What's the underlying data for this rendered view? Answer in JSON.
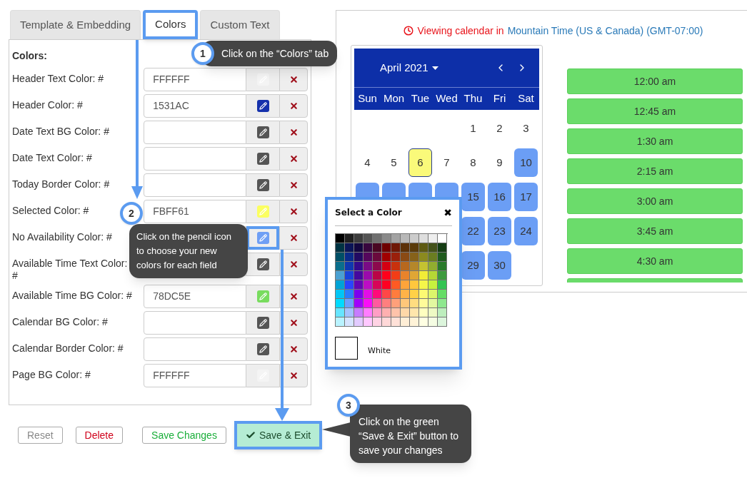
{
  "tabs": [
    {
      "label": "Template & Embedding",
      "selected": false,
      "highlighted": false
    },
    {
      "label": "Colors",
      "selected": true,
      "highlighted": true
    },
    {
      "label": "Custom Text",
      "selected": false,
      "highlighted": false
    }
  ],
  "section_title": "Colors:",
  "color_fields": [
    {
      "label": "Header Text Color: #",
      "value": "FFFFFF",
      "color": "#f4f4f4",
      "highlighted": false
    },
    {
      "label": "Header Color: #",
      "value": "1531AC",
      "color": "#1531ac",
      "highlighted": false
    },
    {
      "label": "Date Text BG Color: #",
      "color": "#555555",
      "highlighted": false
    },
    {
      "label": "Date Text Color: #",
      "color": "#555555",
      "highlighted": false
    },
    {
      "label": "Today Border Color: #",
      "color": "#555555",
      "highlighted": false
    },
    {
      "label": "Selected Color: #",
      "value": "FBFF61",
      "color": "#fbff61",
      "highlighted": false
    },
    {
      "label": "No Availability Color: #",
      "color": "#6f9ff5",
      "highlighted": true
    },
    {
      "label": "Available Time Text Color: #",
      "color": "#555555",
      "highlighted": false
    },
    {
      "label": "Available Time BG Color: #",
      "value": "78DC5E",
      "color": "#78dc5e",
      "highlighted": false
    },
    {
      "label": "Calendar BG Color: #",
      "color": "#555555",
      "highlighted": false
    },
    {
      "label": "Calendar Border Color: #",
      "color": "#555555",
      "highlighted": false
    },
    {
      "label": "Page BG Color: #",
      "value": "FFFFFF",
      "color": "#f4f4f4",
      "highlighted": false
    }
  ],
  "buttons": [
    {
      "label": "Reset",
      "kind": "reset",
      "highlighted": false
    },
    {
      "label": "Delete",
      "kind": "delete",
      "highlighted": false
    },
    {
      "label": "Save Changes",
      "kind": "save",
      "highlighted": false
    },
    {
      "label": "Save & Exit",
      "kind": "primary",
      "highlighted": true
    }
  ],
  "timezone": {
    "prefix": "Viewing calendar in",
    "zone": "Mountain Time (US & Canada) (GMT-07:00)"
  },
  "calendar": {
    "month": "April 2021",
    "weekdays": [
      "Sun",
      "Mon",
      "Tue",
      "Wed",
      "Thu",
      "Fri",
      "Sat"
    ],
    "weeks": [
      [
        {
          "kind": "blank"
        },
        {
          "kind": "blank"
        },
        {
          "kind": "blank"
        },
        {
          "kind": "blank"
        },
        {
          "kind": "day",
          "day": "1",
          "available": false,
          "today": false
        },
        {
          "kind": "day",
          "day": "2",
          "available": false,
          "today": false
        },
        {
          "kind": "day",
          "day": "3",
          "available": false,
          "today": false
        }
      ],
      [
        {
          "kind": "day",
          "day": "4",
          "available": false,
          "today": false
        },
        {
          "kind": "day",
          "day": "5",
          "available": false,
          "today": false
        },
        {
          "kind": "day",
          "day": "6",
          "available": false,
          "today": true
        },
        {
          "kind": "day",
          "day": "7",
          "available": false,
          "today": false
        },
        {
          "kind": "day",
          "day": "8",
          "available": false,
          "today": false
        },
        {
          "kind": "day",
          "day": "9",
          "available": false,
          "today": false
        },
        {
          "kind": "day",
          "day": "10",
          "available": true,
          "today": false
        }
      ],
      [
        {
          "kind": "covered"
        },
        {
          "kind": "covered"
        },
        {
          "kind": "covered"
        },
        {
          "kind": "covered"
        },
        {
          "kind": "day",
          "day": "15",
          "available": true,
          "today": false
        },
        {
          "kind": "day",
          "day": "16",
          "available": true,
          "today": false
        },
        {
          "kind": "day",
          "day": "17",
          "available": true,
          "today": false
        }
      ],
      [
        {
          "kind": "blank"
        },
        {
          "kind": "blank"
        },
        {
          "kind": "blank"
        },
        {
          "kind": "blank"
        },
        {
          "kind": "day",
          "day": "22",
          "available": true,
          "today": false
        },
        {
          "kind": "day",
          "day": "23",
          "available": true,
          "today": false
        },
        {
          "kind": "day",
          "day": "24",
          "available": true,
          "today": false
        }
      ],
      [
        {
          "kind": "blank"
        },
        {
          "kind": "blank"
        },
        {
          "kind": "blank"
        },
        {
          "kind": "blank"
        },
        {
          "kind": "day",
          "day": "29",
          "available": true,
          "today": false
        },
        {
          "kind": "day",
          "day": "30",
          "available": true,
          "today": false
        },
        {
          "kind": "blank"
        }
      ]
    ]
  },
  "time_slots": [
    "12:00 am",
    "12:45 am",
    "1:30 am",
    "2:15 am",
    "3:00 am",
    "3:45 am",
    "4:30 am"
  ],
  "color_picker": {
    "title": "Select a Color",
    "close": "✖",
    "palette": [
      [
        {
          "color": "#000000"
        },
        {
          "color": "#1f1f1f"
        },
        {
          "color": "#3d3d3d"
        },
        {
          "color": "#545454"
        },
        {
          "color": "#707070"
        },
        {
          "color": "#8a8a8a"
        },
        {
          "color": "#a3a3a3"
        },
        {
          "color": "#b8b8b8"
        },
        {
          "color": "#cccccc"
        },
        {
          "color": "#dedede"
        },
        {
          "color": "#eeeeee"
        },
        {
          "color": "#ffffff"
        }
      ],
      [
        {
          "color": "#003343"
        },
        {
          "color": "#0b1558"
        },
        {
          "color": "#13073f"
        },
        {
          "color": "#38073e"
        },
        {
          "color": "#4a0723"
        },
        {
          "color": "#6e0000"
        },
        {
          "color": "#6f1806"
        },
        {
          "color": "#5c3108"
        },
        {
          "color": "#5a3b0a"
        },
        {
          "color": "#5e5a12"
        },
        {
          "color": "#44521a"
        },
        {
          "color": "#153c13"
        }
      ],
      [
        {
          "color": "#004f66"
        },
        {
          "color": "#0a2b8a"
        },
        {
          "color": "#220a63"
        },
        {
          "color": "#55075c"
        },
        {
          "color": "#6a0a3c"
        },
        {
          "color": "#a00000"
        },
        {
          "color": "#9a200b"
        },
        {
          "color": "#8a4a14"
        },
        {
          "color": "#86621a"
        },
        {
          "color": "#8b8a1f"
        },
        {
          "color": "#6a7d21"
        },
        {
          "color": "#1f5b1d"
        }
      ],
      [
        {
          "color": "#0a6e8c"
        },
        {
          "color": "#0f38b0"
        },
        {
          "color": "#340b8e"
        },
        {
          "color": "#7a0b86"
        },
        {
          "color": "#8c0a4d"
        },
        {
          "color": "#d40012"
        },
        {
          "color": "#c9310d"
        },
        {
          "color": "#b7681e"
        },
        {
          "color": "#b5872a"
        },
        {
          "color": "#c4c231"
        },
        {
          "color": "#91ad2f"
        },
        {
          "color": "#2a7a2a"
        }
      ],
      [
        {
          "color": "#4aa0d2"
        },
        {
          "color": "#1a43db"
        },
        {
          "color": "#45089e"
        },
        {
          "color": "#9b0aac"
        },
        {
          "color": "#ba0546"
        },
        {
          "color": "#ff001b"
        },
        {
          "color": "#f33d16"
        },
        {
          "color": "#e9832b"
        },
        {
          "color": "#e0a635"
        },
        {
          "color": "#f2ec36"
        },
        {
          "color": "#b5d734"
        },
        {
          "color": "#3d9a3d"
        }
      ],
      [
        {
          "color": "#00a3d6"
        },
        {
          "color": "#2a44ff"
        },
        {
          "color": "#6405b4"
        },
        {
          "color": "#bd0dc4"
        },
        {
          "color": "#d70558"
        },
        {
          "color": "#ff0022"
        },
        {
          "color": "#ff5a23"
        },
        {
          "color": "#ffa43a"
        },
        {
          "color": "#ffc73d"
        },
        {
          "color": "#f6f64a"
        },
        {
          "color": "#c7f23e"
        },
        {
          "color": "#33c452"
        }
      ],
      [
        {
          "color": "#00c6f5"
        },
        {
          "color": "#2b7cff"
        },
        {
          "color": "#7c00ee"
        },
        {
          "color": "#e20ee6"
        },
        {
          "color": "#ff0a7a"
        },
        {
          "color": "#ff4747"
        },
        {
          "color": "#ff7c3d"
        },
        {
          "color": "#ffb347"
        },
        {
          "color": "#ffd147"
        },
        {
          "color": "#fdfa73"
        },
        {
          "color": "#ddf56b"
        },
        {
          "color": "#66dd66"
        }
      ],
      [
        {
          "color": "#00dbff"
        },
        {
          "color": "#6b9fff"
        },
        {
          "color": "#a000fb"
        },
        {
          "color": "#f90ef6"
        },
        {
          "color": "#ff5a9e"
        },
        {
          "color": "#ff7f7f"
        },
        {
          "color": "#ffa07a"
        },
        {
          "color": "#ffc77a"
        },
        {
          "color": "#ffdd80"
        },
        {
          "color": "#fffb9a"
        },
        {
          "color": "#e3f8a0"
        },
        {
          "color": "#8ee88e"
        }
      ],
      [
        {
          "color": "#66e5ff"
        },
        {
          "color": "#a4c2ff"
        },
        {
          "color": "#c67bff"
        },
        {
          "color": "#ff7cff"
        },
        {
          "color": "#ff9ec5"
        },
        {
          "color": "#ffb0b0"
        },
        {
          "color": "#ffc3aa"
        },
        {
          "color": "#ffd8a8"
        },
        {
          "color": "#ffe6ac"
        },
        {
          "color": "#ffffc0"
        },
        {
          "color": "#eefac4"
        },
        {
          "color": "#bdeebd"
        }
      ],
      [
        {
          "color": "#b9f3ff"
        },
        {
          "color": "#d6e4ff"
        },
        {
          "color": "#e2cbff"
        },
        {
          "color": "#ffc8ff"
        },
        {
          "color": "#ffd3e4"
        },
        {
          "color": "#ffd8d8"
        },
        {
          "color": "#ffe1d8"
        },
        {
          "color": "#ffeed6"
        },
        {
          "color": "#fff3d8"
        },
        {
          "color": "#ffffe3"
        },
        {
          "color": "#f5fde3"
        },
        {
          "color": "#dcf5dc"
        }
      ]
    ],
    "current": {
      "color": "#ffffff",
      "label": "White"
    }
  },
  "callouts": [
    {
      "number": "1",
      "text": "Click on the “Colors” tab"
    },
    {
      "number": "2",
      "text": "Click on the pencil icon to choose your new colors for each field"
    },
    {
      "number": "3",
      "text": "Click on the green “Save & Exit” button to save your changes"
    }
  ]
}
